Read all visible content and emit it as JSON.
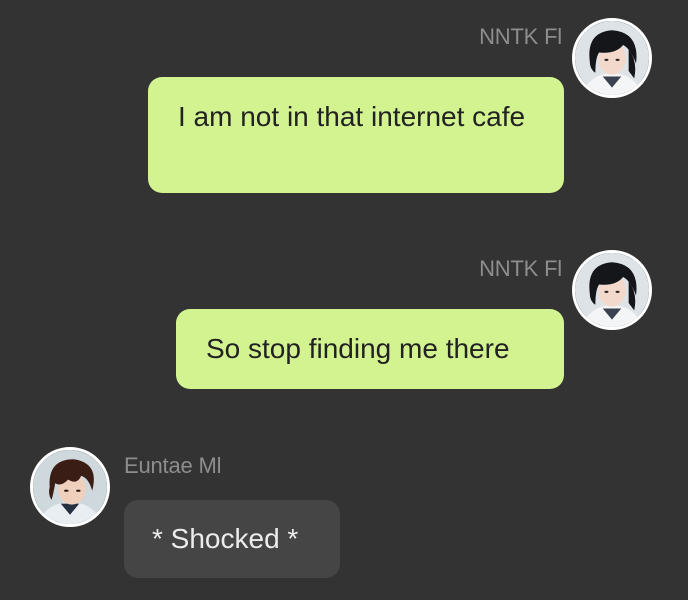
{
  "messages": [
    {
      "sender": "NNTK Fl",
      "direction": "outgoing",
      "avatar_icon": "avatar-girl-dark-hair-icon",
      "text": "I am not in that internet cafe"
    },
    {
      "sender": "NNTK Fl",
      "direction": "outgoing",
      "avatar_icon": "avatar-girl-dark-hair-icon",
      "text": "So stop finding me there"
    },
    {
      "sender": "Euntae Ml",
      "direction": "incoming",
      "avatar_icon": "avatar-boy-brown-hair-icon",
      "text": "* Shocked *"
    }
  ],
  "colors": {
    "background": "#333333",
    "outgoing_bubble": "#d3f391",
    "incoming_bubble": "#454545",
    "sender_name": "#8d8d8d"
  }
}
